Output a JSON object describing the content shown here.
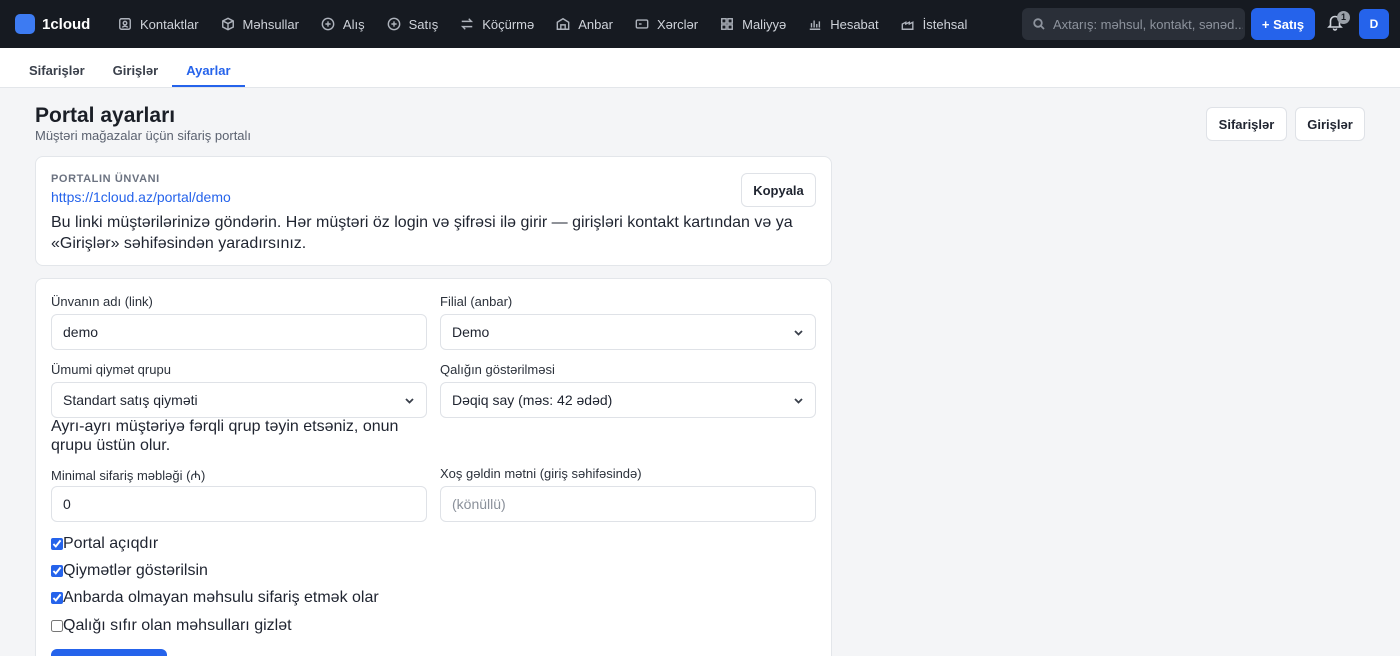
{
  "brand": {
    "name": "1cloud",
    "color": "#3d7bf2"
  },
  "nav": {
    "items": [
      {
        "label": "Kontaktlar",
        "icon": "contacts-icon"
      },
      {
        "label": "Məhsullar",
        "icon": "box-icon"
      },
      {
        "label": "Alış",
        "icon": "plus-circle-icon"
      },
      {
        "label": "Satış",
        "icon": "plus-circle-icon"
      },
      {
        "label": "Köçürmə",
        "icon": "transfer-icon"
      },
      {
        "label": "Anbar",
        "icon": "warehouse-icon"
      },
      {
        "label": "Xərclər",
        "icon": "wallet-icon"
      },
      {
        "label": "Maliyyə",
        "icon": "grid-icon"
      },
      {
        "label": "Hesabat",
        "icon": "bar-chart-icon"
      },
      {
        "label": "İstehsal",
        "icon": "factory-icon"
      }
    ]
  },
  "search": {
    "placeholder": "Axtarış: məhsul, kontakt, sənəd..."
  },
  "actions": {
    "sale_button": "+ Satış",
    "notification_count": "1",
    "avatar_initial": "D"
  },
  "subtabs": [
    {
      "label": "Sifarişlər",
      "active": false
    },
    {
      "label": "Girişlər",
      "active": false
    },
    {
      "label": "Ayarlar",
      "active": true
    }
  ],
  "header": {
    "title": "Portal ayarları",
    "subtitle": "Müştəri mağazalar üçün sifariş portalı",
    "orders_button": "Sifarişlər",
    "logins_button": "Girişlər"
  },
  "portal_url": {
    "label": "PORTALIN ÜNVANI",
    "url": "https://1cloud.az/portal/demo",
    "copy_button": "Kopyala",
    "note": "Bu linki müştərilərinizə göndərin. Hər müştəri öz login və şifrəsi ilə girir — girişləri kontakt kartından və ya «Girişlər» səhifəsindən yaradırsınız."
  },
  "form": {
    "slug": {
      "label": "Ünvanın adı (link)",
      "value": "demo"
    },
    "branch": {
      "label": "Filial (anbar)",
      "value": "Demo"
    },
    "price_group": {
      "label": "Ümumi qiymət qrupu",
      "value": "Standart satış qiyməti",
      "hint": "Ayrı-ayrı müştəriyə fərqli qrup təyin etsəniz, onun qrupu üstün olur."
    },
    "stock_display": {
      "label": "Qalığın göstərilməsi",
      "value": "Dəqiq say (məs: 42 ədəd)"
    },
    "min_order": {
      "label": "Minimal sifariş məbləği (₼)",
      "value": "0"
    },
    "welcome_text": {
      "label": "Xoş gəldin mətni (giriş səhifəsində)",
      "placeholder": "(könüllü)"
    },
    "checkboxes": [
      {
        "label": "Portal açıqdır",
        "checked": true
      },
      {
        "label": "Qiymətlər göstərilsin",
        "checked": true
      },
      {
        "label": "Anbarda olmayan məhsulu sifariş etmək olar",
        "checked": true
      },
      {
        "label": "Qalığı sıfır olan məhsulları gizlət",
        "checked": false
      }
    ]
  },
  "colors": {
    "accent": "#2563eb",
    "topbar": "#161a21"
  }
}
